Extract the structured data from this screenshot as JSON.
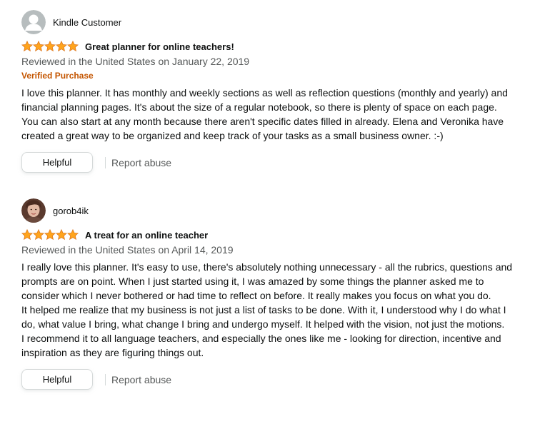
{
  "colors": {
    "star": "#ffa41c",
    "verified": "#c45500",
    "meta_text": "#565959",
    "body_text": "#0f1111"
  },
  "reviews": [
    {
      "profile_name": "Kindle Customer",
      "avatar_icon": "default-user-icon",
      "rating": 5,
      "rating_max": 5,
      "title": "Great planner for online teachers!",
      "date": "Reviewed in the United States on January 22, 2019",
      "verified": "Verified Purchase",
      "body": [
        "I love this planner. It has monthly and weekly sections as well as reflection questions (monthly and yearly) and financial planning pages. It's about the size of a regular notebook, so there is plenty of space on each page. You can also start at any month because there aren't specific dates filled in already. Elena and Veronika have created a great way to be organized and keep track of your tasks as a small business owner. :-)"
      ],
      "helpful_label": "Helpful",
      "report_label": "Report abuse"
    },
    {
      "profile_name": "gorob4ik",
      "avatar_icon": "user-photo",
      "rating": 5,
      "rating_max": 5,
      "title": "A treat for an online teacher",
      "date": "Reviewed in the United States on April 14, 2019",
      "body": [
        "I really love this planner. It's easy to use, there's absolutely nothing unnecessary - all the rubrics, questions and prompts are on point. When I just started using it, I was amazed by some things the planner asked me to consider which I never bothered or had time to reflect on before. It really makes you focus on what you do.",
        "It helped me realize that my business is not just a list of tasks to be done. With it, I understood why I do what I do, what value I bring, what change I bring and undergo myself. It helped with the vision, not just the motions.",
        "I recommend it to all language teachers, and especially the ones like me - looking for direction, incentive and inspiration as they are figuring things out."
      ],
      "helpful_label": "Helpful",
      "report_label": "Report abuse"
    }
  ]
}
